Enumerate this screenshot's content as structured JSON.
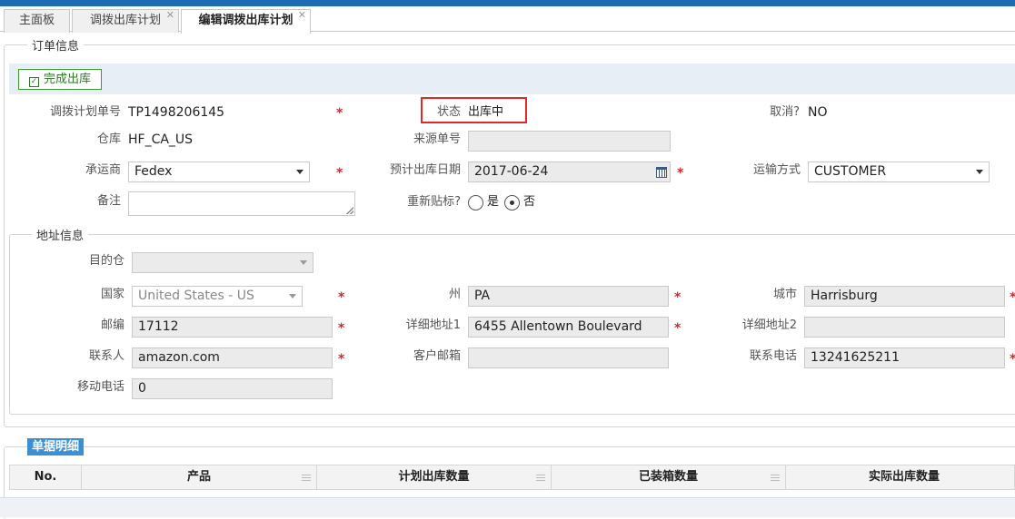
{
  "tabs": [
    {
      "label": "主面板",
      "closable": false
    },
    {
      "label": "调拨出库计划",
      "closable": true
    },
    {
      "label": "编辑调拨出库计划",
      "closable": true,
      "active": true
    }
  ],
  "order_section": {
    "legend": "订单信息",
    "complete_button": "完成出库",
    "transfer_plan_no": {
      "label": "调拨计划单号",
      "value": "TP1498206145"
    },
    "status": {
      "label": "状态",
      "value": "出库中"
    },
    "cancel": {
      "label": "取消?",
      "value": "NO"
    },
    "warehouse": {
      "label": "仓库",
      "value": "HF_CA_US"
    },
    "source_no": {
      "label": "来源单号",
      "value": ""
    },
    "carrier": {
      "label": "承运商",
      "value": "Fedex"
    },
    "expected_date": {
      "label": "预计出库日期",
      "value": "2017-06-24"
    },
    "shipping_method": {
      "label": "运输方式",
      "value": "CUSTOMER"
    },
    "remark": {
      "label": "备注",
      "value": ""
    },
    "relabel": {
      "label": "重新贴标?",
      "yes": "是",
      "no": "否",
      "selected": "no"
    }
  },
  "address_section": {
    "legend": "地址信息",
    "destination_warehouse": {
      "label": "目的仓",
      "value": ""
    },
    "country": {
      "label": "国家",
      "value": "United States - US"
    },
    "state": {
      "label": "州",
      "value": "PA"
    },
    "city": {
      "label": "城市",
      "value": "Harrisburg"
    },
    "zip": {
      "label": "邮编",
      "value": "17112"
    },
    "address1": {
      "label": "详细地址1",
      "value": "6455 Allentown Boulevard"
    },
    "address2": {
      "label": "详细地址2",
      "value": ""
    },
    "contact": {
      "label": "联系人",
      "value": "amazon.com"
    },
    "email": {
      "label": "客户邮箱",
      "value": ""
    },
    "phone": {
      "label": "联系电话",
      "value": "13241625211"
    },
    "mobile": {
      "label": "移动电话",
      "value": "0"
    }
  },
  "detail_section": {
    "title": "单据明细",
    "columns": [
      "No.",
      "产品",
      "计划出库数量",
      "已装箱数量",
      "实际出库数量"
    ]
  },
  "required_mark": "*",
  "colors": {
    "accent": "#1c6cb4",
    "required": "#d3272e",
    "success": "#3d9b35",
    "highlight": "#e02a2a"
  }
}
